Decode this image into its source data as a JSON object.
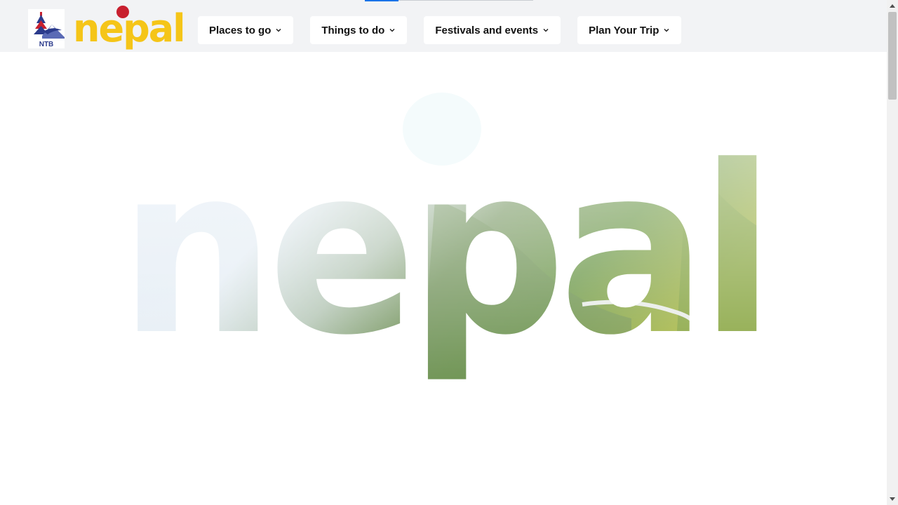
{
  "site": {
    "brand_word": "nepal",
    "emblem_text": "NTB",
    "brand_color": "#f5c518",
    "dot_color": "#c8202f"
  },
  "nav": {
    "items": [
      {
        "label": "Places to go",
        "icon": "chevron-down-icon"
      },
      {
        "label": "Things to do",
        "icon": "chevron-down-icon"
      },
      {
        "label": "Festivals and events",
        "icon": "chevron-down-icon"
      },
      {
        "label": "Plan Your Trip",
        "icon": "chevron-down-icon"
      }
    ]
  },
  "hero": {
    "word": "nepal"
  },
  "top_progress": {
    "fraction": 0.2,
    "accent": "#1a73e8"
  }
}
